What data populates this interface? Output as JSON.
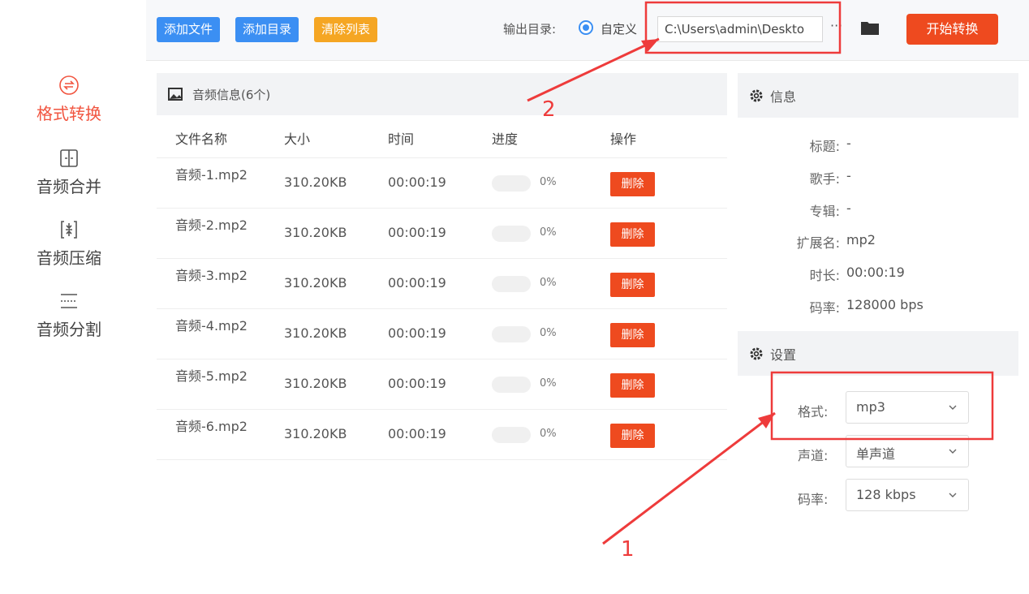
{
  "sidebar": {
    "items": [
      {
        "label": "格式转换",
        "icon": "format-convert-icon",
        "active": true
      },
      {
        "label": "音频合并",
        "icon": "audio-merge-icon",
        "active": false
      },
      {
        "label": "音频压缩",
        "icon": "audio-compress-icon",
        "active": false
      },
      {
        "label": "音频分割",
        "icon": "audio-split-icon",
        "active": false
      }
    ]
  },
  "toolbar": {
    "add_file": "添加文件",
    "add_dir": "添加目录",
    "clear_list": "清除列表",
    "output_label": "输出目录:",
    "custom_label": "自定义",
    "output_path": "C:\\Users\\admin\\Deskto",
    "more": "···",
    "start": "开始转换"
  },
  "list": {
    "title": "音频信息(6个)",
    "columns": [
      "文件名称",
      "大小",
      "时间",
      "进度",
      "操作"
    ],
    "rows": [
      {
        "name": "音频-1.mp2",
        "size": "310.20KB",
        "time": "00:00:19",
        "progress": 0,
        "progress_text": "0%",
        "action": "删除"
      },
      {
        "name": "音频-2.mp2",
        "size": "310.20KB",
        "time": "00:00:19",
        "progress": 0,
        "progress_text": "0%",
        "action": "删除"
      },
      {
        "name": "音频-3.mp2",
        "size": "310.20KB",
        "time": "00:00:19",
        "progress": 0,
        "progress_text": "0%",
        "action": "删除"
      },
      {
        "name": "音频-4.mp2",
        "size": "310.20KB",
        "time": "00:00:19",
        "progress": 0,
        "progress_text": "0%",
        "action": "删除"
      },
      {
        "name": "音频-5.mp2",
        "size": "310.20KB",
        "time": "00:00:19",
        "progress": 0,
        "progress_text": "0%",
        "action": "删除"
      },
      {
        "name": "音频-6.mp2",
        "size": "310.20KB",
        "time": "00:00:19",
        "progress": 0,
        "progress_text": "0%",
        "action": "删除"
      }
    ]
  },
  "info": {
    "title": "信息",
    "fields": [
      {
        "label": "标题:",
        "value": "-"
      },
      {
        "label": "歌手:",
        "value": "-"
      },
      {
        "label": "专辑:",
        "value": "-"
      },
      {
        "label": "扩展名:",
        "value": "mp2"
      },
      {
        "label": "时长:",
        "value": "00:00:19"
      },
      {
        "label": "码率:",
        "value": "128000 bps"
      }
    ]
  },
  "settings": {
    "title": "设置",
    "format_label": "格式:",
    "format_value": "mp3",
    "channel_label": "声道:",
    "channel_value": "单声道",
    "bitrate_label": "码率:",
    "bitrate_value": "128 kbps"
  },
  "annotations": {
    "label_1": "1",
    "label_2": "2",
    "color": "#ee3b3b"
  },
  "colors": {
    "accent_red": "#ee4a1f",
    "accent_blue": "#3b8ff3",
    "accent_orange": "#f5a623"
  }
}
